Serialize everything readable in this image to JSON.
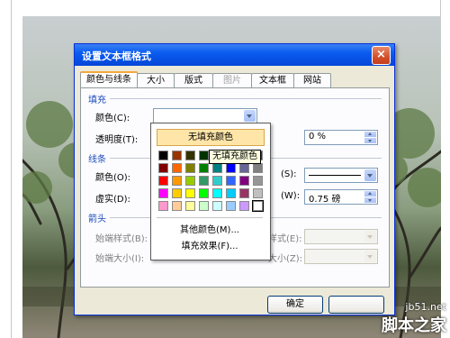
{
  "dialog": {
    "title": "设置文本框格式",
    "close_symbol": "×"
  },
  "tabs": [
    {
      "label": "颜色与线条",
      "active": true,
      "enabled": true
    },
    {
      "label": "大小",
      "active": false,
      "enabled": true
    },
    {
      "label": "版式",
      "active": false,
      "enabled": true
    },
    {
      "label": "图片",
      "active": false,
      "enabled": false
    },
    {
      "label": "文本框",
      "active": false,
      "enabled": true
    },
    {
      "label": "网站",
      "active": false,
      "enabled": true
    }
  ],
  "fill": {
    "section": "填充",
    "color_label": "颜色(C):",
    "color_value": "",
    "transparency_label": "透明度(T):",
    "transparency_value": "0 %"
  },
  "line": {
    "section": "线条",
    "color_label": "颜色(O):",
    "dash_label": "虚实(D):",
    "style_label_partial": "(S):",
    "weight_label_partial": "(W):",
    "weight_value": "0.75 磅"
  },
  "arrow": {
    "section": "箭头",
    "begin_style_label": "始端样式(B):",
    "begin_size_label": "始端大小(I):",
    "end_style_label_partial": "样式(E):",
    "end_size_label_partial": "大小(Z):"
  },
  "buttons": {
    "ok": "确定"
  },
  "palette": {
    "no_fill": "无填充颜色",
    "tooltip": "无填充颜色",
    "more_colors": "其他颜色(M)...",
    "fill_effects": "填充效果(F)...",
    "colors": [
      [
        "#000000",
        "#993300",
        "#333300",
        "#003300",
        "#003366",
        "#000080",
        "#333399",
        "#333333"
      ],
      [
        "#800000",
        "#ff6600",
        "#808000",
        "#008000",
        "#008080",
        "#0000ff",
        "#666699",
        "#808080"
      ],
      [
        "#ff0000",
        "#ff9900",
        "#99cc00",
        "#339966",
        "#33cccc",
        "#3366ff",
        "#800080",
        "#969696"
      ],
      [
        "#ff00ff",
        "#ffcc00",
        "#ffff00",
        "#00ff00",
        "#00ffff",
        "#00ccff",
        "#993366",
        "#c0c0c0"
      ],
      [
        "#ff99cc",
        "#ffcc99",
        "#ffff99",
        "#ccffcc",
        "#ccffff",
        "#99ccff",
        "#cc99ff",
        "#ffffff"
      ]
    ]
  },
  "watermark": {
    "site": "jb51.net",
    "brand": "脚本之家"
  }
}
